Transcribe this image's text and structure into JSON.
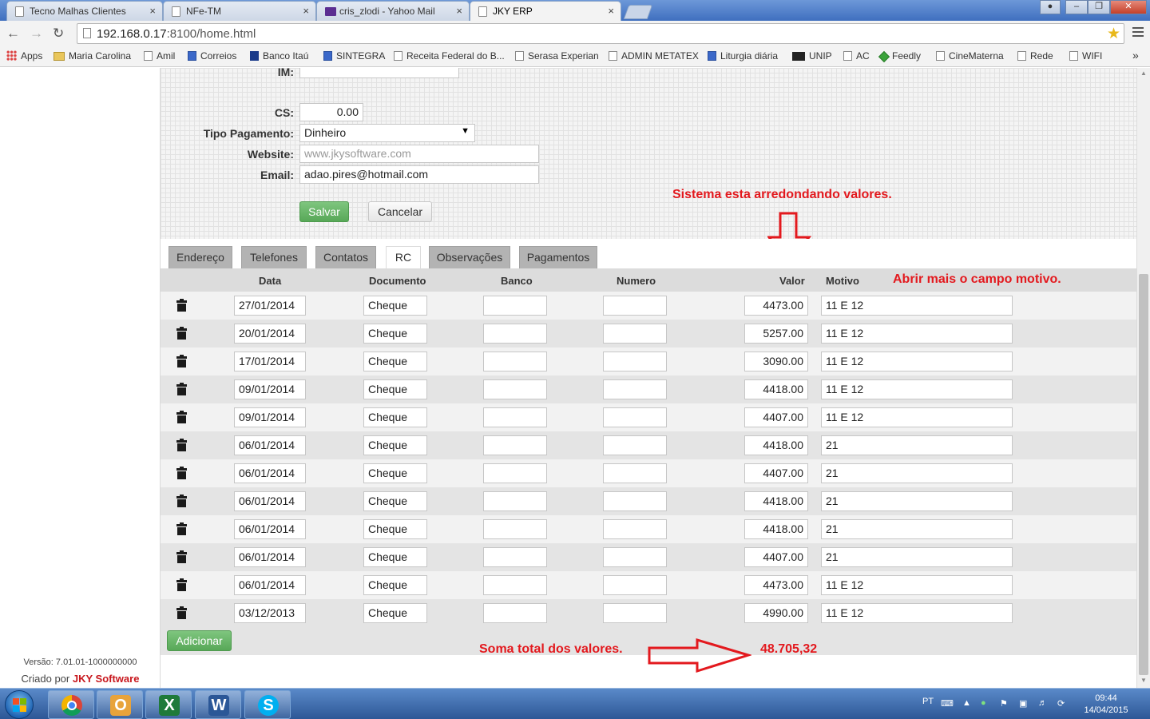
{
  "browser": {
    "tabs": [
      {
        "title": "Tecno Malhas Clientes",
        "close": "×"
      },
      {
        "title": "NFe-TM",
        "close": "×"
      },
      {
        "title": "cris_zlodi - Yahoo Mail",
        "close": "×"
      },
      {
        "title": "JKY ERP",
        "close": "×"
      }
    ],
    "url_host": "192.168.0.17",
    "url_rest": ":8100/home.html",
    "bookmarks": [
      "Apps",
      "Maria Carolina",
      "Amil",
      "Correios",
      "Banco Itaú",
      "SINTEGRA",
      "Receita Federal do B...",
      "Serasa Experian",
      "ADMIN METATEX",
      "Liturgia diária",
      "UNIP",
      "AC",
      "Feedly",
      "CineMaterna",
      "Rede",
      "WIFI"
    ],
    "more": "»"
  },
  "form": {
    "im_label": "IM:",
    "cs_label": "CS:",
    "cs_value": "0.00",
    "tipo_label": "Tipo Pagamento:",
    "tipo_value": "Dinheiro",
    "website_label": "Website:",
    "website_placeholder": "www.jkysoftware.com",
    "email_label": "Email:",
    "email_value": "adao.pires@hotmail.com",
    "save_label": "Salvar",
    "cancel_label": "Cancelar"
  },
  "tabs": [
    "Endereço",
    "Telefones",
    "Contatos",
    "RC",
    "Observações",
    "Pagamentos"
  ],
  "active_tab": "RC",
  "table": {
    "headers": [
      "Data",
      "Documento",
      "Banco",
      "Numero",
      "Valor",
      "Motivo"
    ],
    "rows": [
      {
        "data": "27/01/2014",
        "documento": "Cheque",
        "banco": "",
        "numero": "",
        "valor": "4473.00",
        "motivo": "11 E 12"
      },
      {
        "data": "20/01/2014",
        "documento": "Cheque",
        "banco": "",
        "numero": "",
        "valor": "5257.00",
        "motivo": "11 E 12"
      },
      {
        "data": "17/01/2014",
        "documento": "Cheque",
        "banco": "",
        "numero": "",
        "valor": "3090.00",
        "motivo": "11 E 12"
      },
      {
        "data": "09/01/2014",
        "documento": "Cheque",
        "banco": "",
        "numero": "",
        "valor": "4418.00",
        "motivo": "11 E 12"
      },
      {
        "data": "09/01/2014",
        "documento": "Cheque",
        "banco": "",
        "numero": "",
        "valor": "4407.00",
        "motivo": "11 E 12"
      },
      {
        "data": "06/01/2014",
        "documento": "Cheque",
        "banco": "",
        "numero": "",
        "valor": "4418.00",
        "motivo": "21"
      },
      {
        "data": "06/01/2014",
        "documento": "Cheque",
        "banco": "",
        "numero": "",
        "valor": "4407.00",
        "motivo": "21"
      },
      {
        "data": "06/01/2014",
        "documento": "Cheque",
        "banco": "",
        "numero": "",
        "valor": "4418.00",
        "motivo": "21"
      },
      {
        "data": "06/01/2014",
        "documento": "Cheque",
        "banco": "",
        "numero": "",
        "valor": "4418.00",
        "motivo": "21"
      },
      {
        "data": "06/01/2014",
        "documento": "Cheque",
        "banco": "",
        "numero": "",
        "valor": "4407.00",
        "motivo": "21"
      },
      {
        "data": "06/01/2014",
        "documento": "Cheque",
        "banco": "",
        "numero": "",
        "valor": "4473.00",
        "motivo": "11 E 12"
      },
      {
        "data": "03/12/2013",
        "documento": "Cheque",
        "banco": "",
        "numero": "",
        "valor": "4990.00",
        "motivo": "11 E 12"
      }
    ],
    "add_label": "Adicionar"
  },
  "annotations": {
    "rounding": "Sistema esta arredondando valores.",
    "motivo": "Abrir mais o campo motivo.",
    "total_label": "Soma total dos valores.",
    "total_value": "48.705,32"
  },
  "sidebar": {
    "version": "Versão: 7.01.01-1000000000",
    "created_prefix": "Criado por",
    "created_brand": "JKY Software"
  },
  "taskbar": {
    "lang": "PT",
    "time": "09:44",
    "date": "14/04/2015"
  },
  "colors": {
    "annotation": "#e3191e",
    "green_button": "#5cb85c",
    "tab_strip": "#4a7cc9"
  }
}
